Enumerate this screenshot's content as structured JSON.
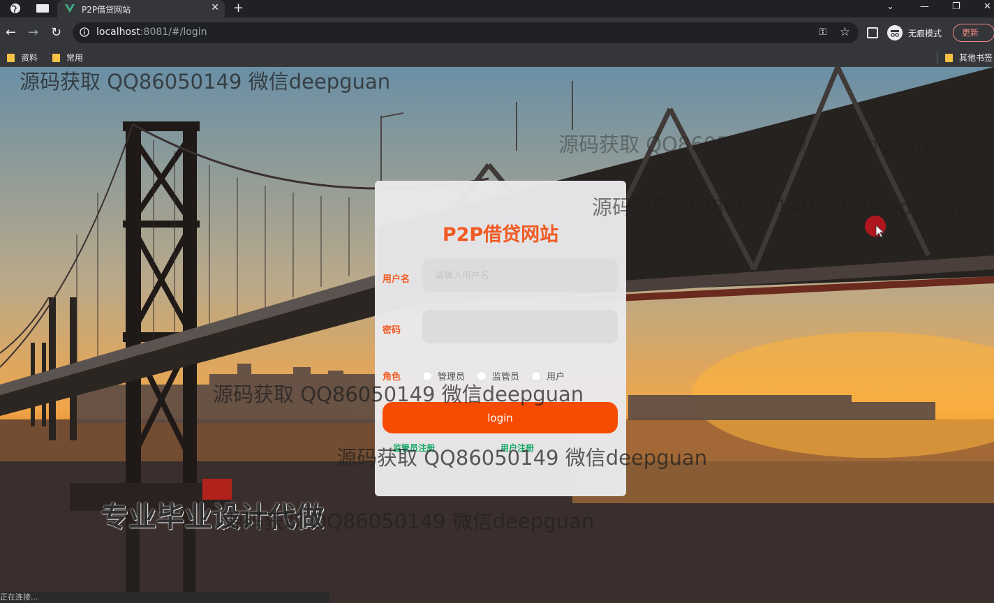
{
  "browser": {
    "tab_title": "P2P借贷网站",
    "new_tab": "+",
    "url_host": "localhost",
    "url_rest": ":8081/#/login",
    "incognito_label": "无痕模式",
    "update_label": "更新",
    "bookmarks": [
      "资料",
      "常用"
    ],
    "other_bookmarks": "其他书签",
    "status_text": "正在连接..."
  },
  "login": {
    "title": "P2P借贷网站",
    "username_label": "用户名",
    "username_placeholder": "请输入用户名",
    "password_label": "密码",
    "role_label": "角色",
    "roles": [
      "管理员",
      "监管员",
      "用户"
    ],
    "login_button": "login",
    "register_links": [
      "监管员注册",
      "用户注册"
    ]
  },
  "overlay": {
    "ad_text": "专业毕业设计代做",
    "watermarks": [
      "源码获取 QQ86050149 微信deepguan",
      "源码获取 QQ86050149 微信deepguan",
      "源码获取 QQ86050149 微信deepguan",
      "源码获取 QQ86050149 微信deepguan",
      "源码获取 QQ86050149 微信deepguan",
      "源码获取 QQ86050149 微信deepguan"
    ]
  },
  "colors": {
    "accent": "#f05a23",
    "login_button": "#f54b03",
    "link": "#17a86b"
  }
}
